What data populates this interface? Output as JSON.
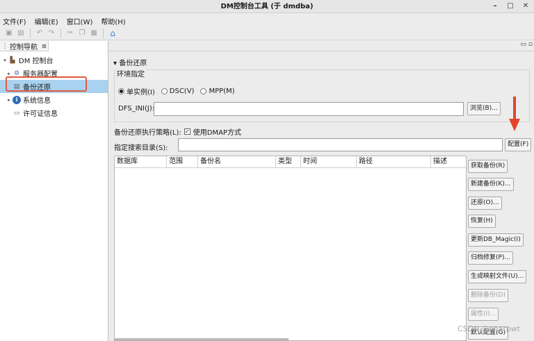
{
  "window": {
    "title": "DM控制台工具 (于 dmdba)",
    "minimize": "–",
    "maximize": "□",
    "close": "✕"
  },
  "menu": [
    "文件(F)",
    "编辑(E)",
    "窗口(W)",
    "帮助(H)"
  ],
  "nav": {
    "tab_label": "控制导航",
    "tab_close": "⊠",
    "items": [
      {
        "label": "DM 控制台",
        "icon": "database-icon",
        "arrow": "▾"
      },
      {
        "label": "服务器配置",
        "icon": "gear-icon",
        "arrow": "▸"
      },
      {
        "label": "备份还原",
        "icon": "backup-icon",
        "arrow": ""
      },
      {
        "label": "系统信息",
        "icon": "info-icon",
        "arrow": "▸"
      },
      {
        "label": "许可证信息",
        "icon": "license-icon",
        "arrow": ""
      }
    ]
  },
  "panel": {
    "header_ctrls": "▭ ▫",
    "title": "▾ 备份还原",
    "env_legend": "环境指定",
    "radios": [
      {
        "label": "单实例(I)",
        "selected": true
      },
      {
        "label": "DSC(V)",
        "selected": false
      },
      {
        "label": "MPP(M)",
        "selected": false
      }
    ],
    "dfs_label": "DFS_INI(J):",
    "dfs_value": "",
    "browse": "浏览(B)...",
    "strategy_label": "备份还原执行策略(L):",
    "dmap_checked": true,
    "dmap_label": "使用DMAP方式",
    "search_label": "指定搜索目录(S):",
    "search_value": "",
    "config": "配置(F)",
    "columns": [
      "数据库",
      "范围",
      "备份名",
      "类型",
      "时间",
      "路径",
      "描述"
    ],
    "buttons": [
      {
        "label": "获取备份(R)",
        "enabled": true
      },
      {
        "label": "新建备份(K)...",
        "enabled": true
      },
      {
        "label": "还原(O)...",
        "enabled": true
      },
      {
        "label": "恢复(H)",
        "enabled": true
      },
      {
        "label": "更新DB_Magic(I)",
        "enabled": true
      },
      {
        "label": "归档修复(P)...",
        "enabled": true
      },
      {
        "label": "生成映射文件(U)...",
        "enabled": true
      },
      {
        "label": "删除备份(D)",
        "enabled": false
      },
      {
        "label": "属性(I)...",
        "enabled": false
      },
      {
        "label": "默认配置(G)",
        "enabled": true
      }
    ]
  },
  "watermark": "CSDN @sharpwt",
  "colors": {
    "selection": "#a9d2f0",
    "highlight_box": "#e05a3f",
    "home_icon": "#2e7bd6"
  }
}
